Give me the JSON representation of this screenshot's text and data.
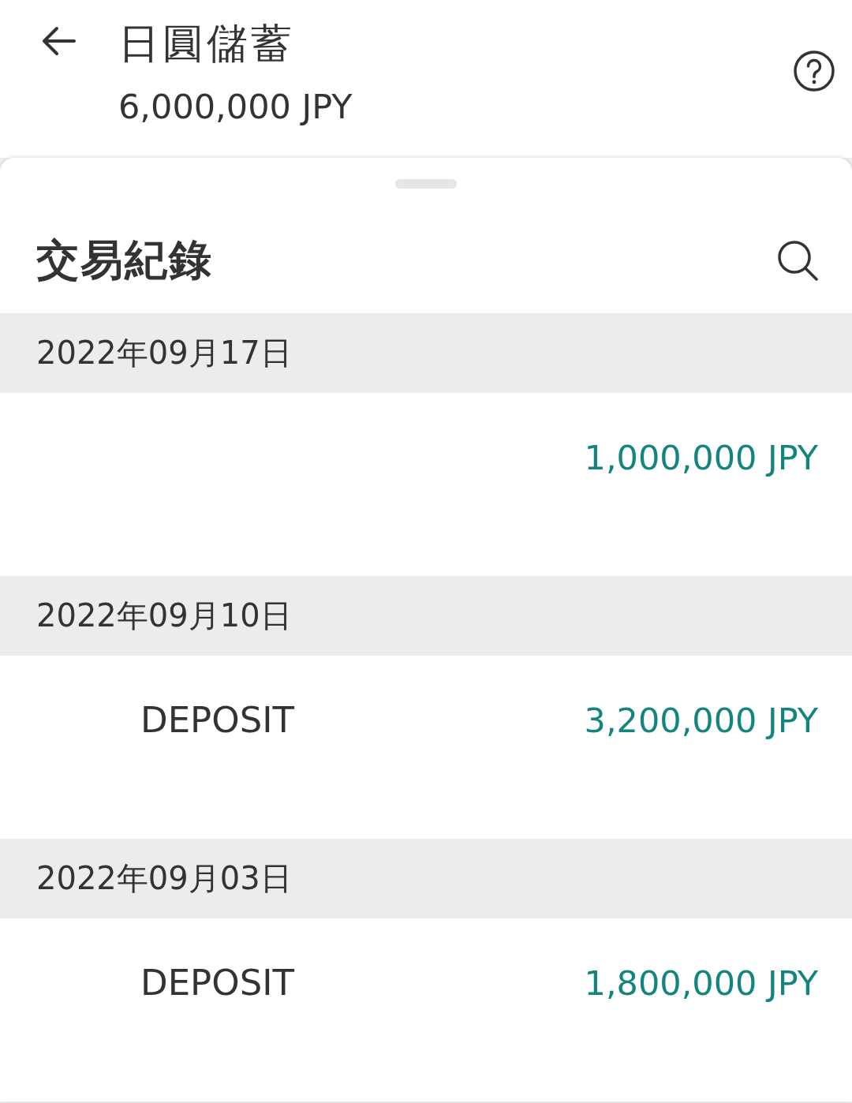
{
  "header": {
    "title": "日圓儲蓄",
    "balance": "6,000,000 JPY"
  },
  "sheet": {
    "title": "交易紀錄"
  },
  "groups": [
    {
      "date": "2022年09月17日",
      "transactions": [
        {
          "amount": "1,000,000 JPY"
        }
      ]
    },
    {
      "date": "2022年09月10日",
      "transactions": [
        {
          "description": "DEPOSIT",
          "amount": "3,200,000 JPY"
        }
      ]
    },
    {
      "date": "2022年09月03日",
      "transactions": [
        {
          "description": "DEPOSIT",
          "amount": "1,800,000 JPY"
        }
      ]
    }
  ]
}
